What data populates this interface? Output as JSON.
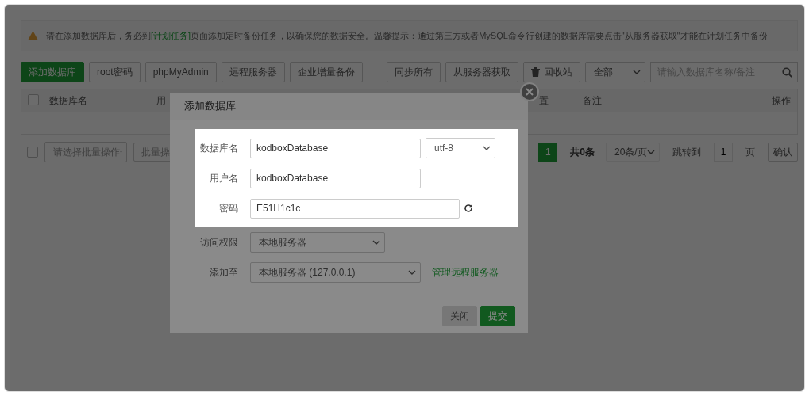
{
  "notice": {
    "before": "请在添加数据库后，务必到",
    "link": "[计划任务]",
    "after": "页面添加定时备份任务，以确保您的数据安全。温馨提示：通过第三方或者MySQL命令行创建的数据库需要点击\"从服务器获取\"才能在计划任务中备份"
  },
  "toolbar": {
    "left_buttons": [
      {
        "label": "添加数据库",
        "kind": "primary"
      },
      {
        "label": "root密码",
        "kind": "plain"
      },
      {
        "label": "phpMyAdmin",
        "kind": "plain"
      },
      {
        "label": "远程服务器",
        "kind": "plain"
      },
      {
        "label": "企业增量备份",
        "kind": "plain"
      }
    ],
    "right_buttons": [
      {
        "label": "同步所有",
        "kind": "plain"
      },
      {
        "label": "从服务器获取",
        "kind": "plain"
      },
      {
        "label": "回收站",
        "kind": "trash"
      }
    ],
    "filter": "全部",
    "search": {
      "placeholder": "请输入数据库名称/备注"
    }
  },
  "table": {
    "select_all": {
      "checked": false
    },
    "columns": [
      "数据库名",
      "用",
      "置",
      "备注",
      "操作"
    ]
  },
  "bulk": {
    "select_all": {
      "checked": false
    },
    "select_placeholder": "请选择批量操作",
    "button": "批量操"
  },
  "pagination": {
    "pages": [
      {
        "label": "1",
        "selected": true
      }
    ],
    "total": "共0条",
    "page_size": "20条/页",
    "jump_label": "跳转到",
    "jump_value": "1",
    "page_unit": "页",
    "confirm": "确认"
  },
  "dialog": {
    "title": "添加数据库",
    "highlighted_fields": [
      {
        "label": "数据库名",
        "value": "kodboxDatabase",
        "kind": "text-select",
        "select": "utf-8"
      },
      {
        "label": "用户名",
        "value": "kodboxDatabase",
        "kind": "text"
      },
      {
        "label": "密码",
        "value": "E51H1c1c",
        "kind": "password"
      }
    ],
    "other_fields": [
      {
        "label": "访问权限",
        "value": "本地服务器",
        "kind": "select"
      },
      {
        "label": "添加至",
        "value": "本地服务器 (127.0.0.1)",
        "kind": "select-link",
        "link": "管理远程服务器"
      }
    ],
    "buttons": [
      {
        "label": "关闭",
        "kind": "disabled"
      },
      {
        "label": "提交",
        "kind": "primary"
      }
    ]
  }
}
